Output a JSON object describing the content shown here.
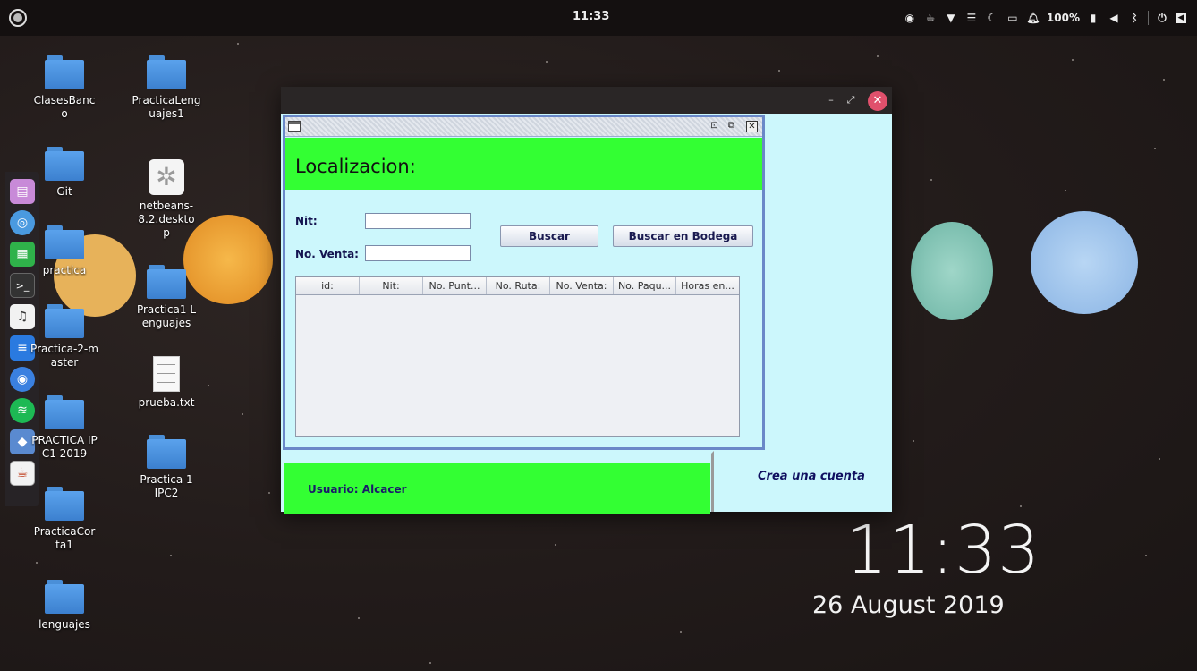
{
  "topbar": {
    "clock": "11:33",
    "battery": "100%"
  },
  "dock": {
    "items": [
      "files-icon",
      "network-icon",
      "spreadsheet-icon",
      "terminal-icon",
      "music-icon",
      "writer-icon",
      "chrome-icon",
      "spotify-icon",
      "virtualbox-icon",
      "java-icon"
    ]
  },
  "desktop": {
    "icons": [
      {
        "label": "ClasesBanco",
        "kind": "folder"
      },
      {
        "label": "PracticaLenguajes1",
        "kind": "folder"
      },
      {
        "label": "Git",
        "kind": "folder"
      },
      {
        "label": "netbeans-8.2.desktop",
        "kind": "app"
      },
      {
        "label": "practica",
        "kind": "folder"
      },
      {
        "label": "Practica1 Lenguajes",
        "kind": "folder"
      },
      {
        "label": "Practica-2-master",
        "kind": "folder"
      },
      {
        "label": "prueba.txt",
        "kind": "text"
      },
      {
        "label": "PRACTICA IPC1 2019",
        "kind": "folder"
      },
      {
        "label": "Practica 1 IPC2",
        "kind": "folder"
      },
      {
        "label": "PracticaCorta1",
        "kind": "folder"
      },
      {
        "label": "lenguajes",
        "kind": "folder"
      }
    ]
  },
  "clock_widget": {
    "time": "11:33",
    "date": "26 August 2019"
  },
  "app": {
    "footer": {
      "user_label": "Usuario: Alcacer",
      "create_account": "Crea una cuenta"
    },
    "internal_frame": {
      "title": "Localizacion:",
      "nit_label": "Nit:",
      "nit_value": "",
      "venta_label": "No. Venta:",
      "venta_value": "",
      "buscar": "Buscar",
      "buscar_bodega": "Buscar en Bodega",
      "columns": [
        "id:",
        "Nit:",
        "No. Punt...",
        "No. Ruta:",
        "No. Venta:",
        "No. Paqu...",
        "Horas en..."
      ]
    }
  }
}
